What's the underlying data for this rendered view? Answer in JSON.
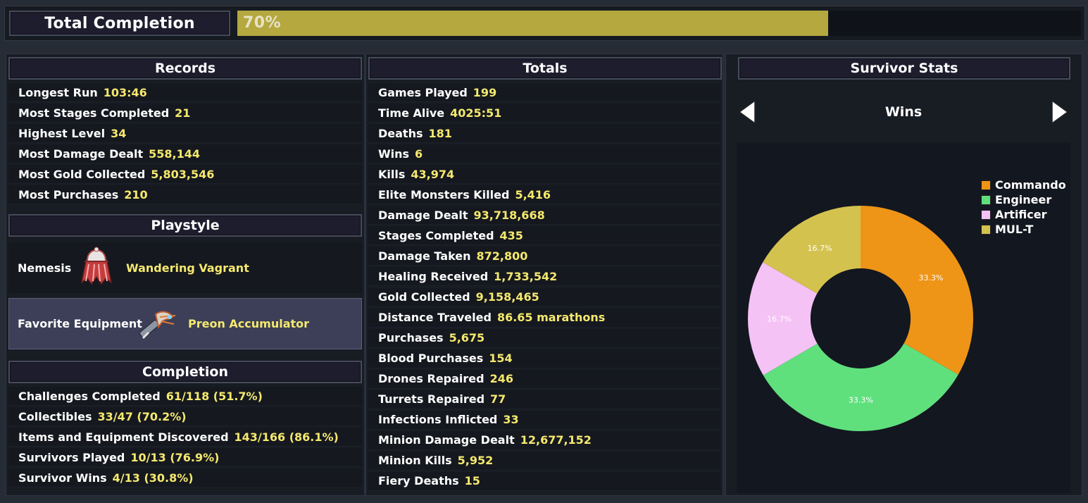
{
  "header": {
    "title": "Total Completion",
    "progress_label": "70%",
    "progress_fraction": 0.7,
    "progress_color": "#b4a83f"
  },
  "records": {
    "title": "Records",
    "rows": [
      {
        "label": "Longest Run",
        "value": "103:46"
      },
      {
        "label": "Most Stages Completed",
        "value": "21"
      },
      {
        "label": "Highest Level",
        "value": "34"
      },
      {
        "label": "Most Damage Dealt",
        "value": "558,144"
      },
      {
        "label": "Most Gold Collected",
        "value": "5,803,546"
      },
      {
        "label": "Most Purchases",
        "value": "210"
      }
    ]
  },
  "playstyle": {
    "title": "Playstyle",
    "nemesis_label": "Nemesis",
    "nemesis_value": "Wandering Vagrant",
    "nemesis_icon": "wandering-vagrant-icon",
    "equipment_label": "Favorite Equipment",
    "equipment_value": "Preon Accumulator",
    "equipment_icon": "preon-accumulator-icon"
  },
  "completion": {
    "title": "Completion",
    "rows": [
      {
        "label": "Challenges Completed",
        "value": "61/118 (51.7%)"
      },
      {
        "label": "Collectibles",
        "value": "33/47 (70.2%)"
      },
      {
        "label": "Items and Equipment Discovered",
        "value": "143/166 (86.1%)"
      },
      {
        "label": "Survivors Played",
        "value": "10/13 (76.9%)"
      },
      {
        "label": "Survivor Wins",
        "value": "4/13 (30.8%)"
      }
    ]
  },
  "totals": {
    "title": "Totals",
    "rows": [
      {
        "label": "Games Played",
        "value": "199"
      },
      {
        "label": "Time Alive",
        "value": "4025:51"
      },
      {
        "label": "Deaths",
        "value": "181"
      },
      {
        "label": "Wins",
        "value": "6"
      },
      {
        "label": "Kills",
        "value": "43,974"
      },
      {
        "label": "Elite Monsters Killed",
        "value": "5,416"
      },
      {
        "label": "Damage Dealt",
        "value": "93,718,668"
      },
      {
        "label": "Stages Completed",
        "value": "435"
      },
      {
        "label": "Damage Taken",
        "value": "872,800"
      },
      {
        "label": "Healing Received",
        "value": "1,733,542"
      },
      {
        "label": "Gold Collected",
        "value": "9,158,465"
      },
      {
        "label": "Distance Traveled",
        "value": "86.65 marathons"
      },
      {
        "label": "Purchases",
        "value": "5,675"
      },
      {
        "label": "Blood Purchases",
        "value": "154"
      },
      {
        "label": "Drones Repaired",
        "value": "246"
      },
      {
        "label": "Turrets Repaired",
        "value": "77"
      },
      {
        "label": "Infections Inflicted",
        "value": "33"
      },
      {
        "label": "Minion Damage Dealt",
        "value": "12,677,152"
      },
      {
        "label": "Minion Kills",
        "value": "5,952"
      },
      {
        "label": "Fiery Deaths",
        "value": "15"
      }
    ]
  },
  "survivor_stats": {
    "title": "Survivor Stats",
    "selected_stat": "Wins",
    "prev_icon": "arrow-left-icon",
    "next_icon": "arrow-right-icon"
  },
  "chart_data": {
    "type": "pie",
    "donut": true,
    "categories": [
      "Commando",
      "Engineer",
      "Artificer",
      "MUL-T"
    ],
    "values": [
      33.3,
      33.3,
      16.7,
      16.7
    ],
    "labels": [
      "33.3%",
      "33.3%",
      "16.7%",
      "16.7%"
    ],
    "colors": [
      "#ee9416",
      "#5fe07d",
      "#f5c2f5",
      "#d4c24f"
    ],
    "legend_position": "top-right"
  }
}
